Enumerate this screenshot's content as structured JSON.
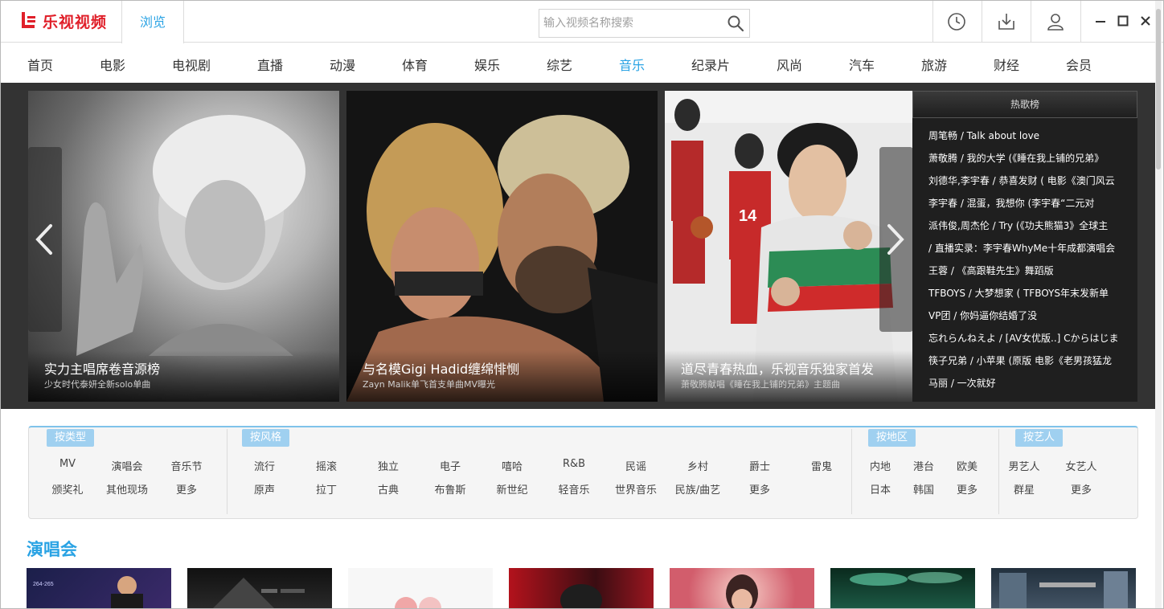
{
  "app": {
    "logo_text": "乐视视频",
    "brand_color": "#e0202a",
    "accent_color": "#2aa3e4"
  },
  "titlebar": {
    "tab_browse": "浏览",
    "search_placeholder": "输入视频名称搜索",
    "icons": [
      "history-icon",
      "download-icon",
      "user-icon",
      "minimize-icon",
      "maximize-icon",
      "close-icon"
    ]
  },
  "nav": {
    "items": [
      "首页",
      "电影",
      "电视剧",
      "直播",
      "动漫",
      "体育",
      "娱乐",
      "综艺",
      "音乐",
      "纪录片",
      "风尚",
      "汽车",
      "旅游",
      "财经",
      "会员"
    ],
    "active": "音乐"
  },
  "banner": {
    "slides": [
      {
        "title": "实力主唱席卷音源榜",
        "subtitle": "少女时代泰妍全新solo单曲"
      },
      {
        "title": "与名模Gigi Hadid缠绵悱恻",
        "subtitle": "Zayn Malik单飞首支单曲MV曝光"
      },
      {
        "title": "道尽青春热血，乐视音乐独家首发",
        "subtitle": "萧敬腾献唱《睡在我上铺的兄弟》主题曲"
      }
    ],
    "hot_list": {
      "title": "热歌榜",
      "items": [
        "周笔畅 / Talk about love",
        "萧敬腾 / 我的大学 (《睡在我上铺的兄弟》",
        "刘德华,李宇春 / 恭喜发财 ( 电影《澳门风云",
        "李宇春 / 混蛋，我想你 (李宇春“二元对",
        "派伟俊,周杰伦 / Try (《功夫熊猫3》全球主",
        "/ 直播实录：李宇春WhyMe十年成都演唱会",
        "王蓉 / 《高跟鞋先生》舞蹈版",
        "TFBOYS / 大梦想家 ( TFBOYS年末发新单",
        "VP团 / 你妈逼你结婚了没",
        "忘れらんねえよ / [AV女优版..] Cからはじま",
        "筷子兄弟 / 小苹果 (原版 电影《老男孩猛龙",
        "马丽 / 一次就好"
      ]
    }
  },
  "filters": {
    "type": {
      "label": "按类型",
      "rows": [
        [
          "MV",
          "演唱会",
          "音乐节"
        ],
        [
          "颁奖礼",
          "其他现场",
          "更多"
        ]
      ]
    },
    "style": {
      "label": "按风格",
      "rows": [
        [
          "流行",
          "摇滚",
          "独立",
          "电子",
          "嘻哈",
          "R&B",
          "民谣",
          "乡村",
          "爵士",
          "雷鬼"
        ],
        [
          "原声",
          "拉丁",
          "古典",
          "布鲁斯",
          "新世纪",
          "轻音乐",
          "世界音乐",
          "民族/曲艺",
          "更多"
        ]
      ]
    },
    "region": {
      "label": "按地区",
      "rows": [
        [
          "内地",
          "港台",
          "欧美"
        ],
        [
          "日本",
          "韩国",
          "更多"
        ]
      ]
    },
    "artist": {
      "label": "按艺人",
      "rows": [
        [
          "男艺人",
          "女艺人"
        ],
        [
          "群星",
          "更多"
        ]
      ]
    }
  },
  "concert": {
    "title": "演唱会"
  }
}
